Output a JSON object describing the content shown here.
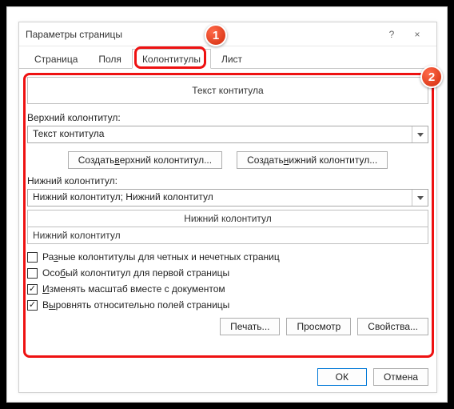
{
  "window": {
    "title": "Параметры страницы",
    "help": "?",
    "close": "×"
  },
  "tabs": {
    "t0": "Страница",
    "t1": "Поля",
    "t2": "Колонтитулы",
    "t3": "Лист"
  },
  "preview_top": "Текст контитула",
  "upper": {
    "label": "Верхний колонтитул:",
    "value": "Текст контитула",
    "create_upper_pre": "Создать ",
    "create_upper_ul": "в",
    "create_upper_post": "ерхний колонтитул...",
    "create_lower_pre": "Создать ",
    "create_lower_ul": "н",
    "create_lower_post": "ижний колонтитул..."
  },
  "lower": {
    "label": "Нижний колонтитул:",
    "value": "Нижний колонтитул; Нижний колонтитул",
    "preview_caption": "Нижний колонтитул",
    "preview_body": "Нижний колонтитул"
  },
  "checks": {
    "c0": {
      "checked": false,
      "pre": "Ра",
      "ul": "з",
      "post": "ные колонтитулы для четных и нечетных страниц"
    },
    "c1": {
      "checked": false,
      "pre": "Осо",
      "ul": "б",
      "post": "ый колонтитул для первой страницы"
    },
    "c2": {
      "checked": true,
      "pre": "",
      "ul": "И",
      "post": "зменять масштаб вместе с документом"
    },
    "c3": {
      "checked": true,
      "pre": "В",
      "ul": "ы",
      "post": "ровнять относительно полей страницы"
    }
  },
  "btns": {
    "print": "Печать...",
    "preview": "Просмотр",
    "props": "Свойства..."
  },
  "footer": {
    "ok": "ОК",
    "cancel": "Отмена"
  },
  "badges": {
    "b1": "1",
    "b2": "2"
  }
}
